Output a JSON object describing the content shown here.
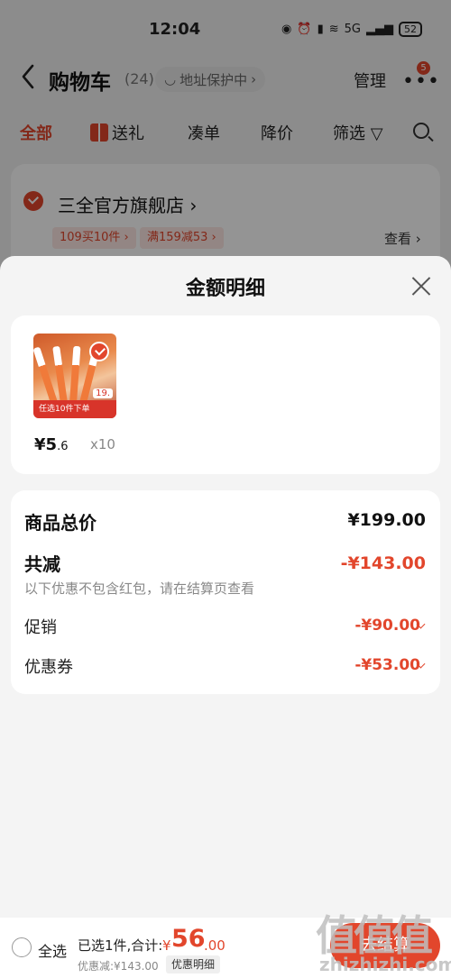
{
  "status_bar": {
    "time": "12:04",
    "network": "5G",
    "battery": "52"
  },
  "nav": {
    "title": "购物车",
    "count": "(24)",
    "address": "地址保护中",
    "manage": "管理",
    "badge": "5"
  },
  "tabs": [
    {
      "label": "全部"
    },
    {
      "label": "送礼"
    },
    {
      "label": "凑单"
    },
    {
      "label": "降价"
    },
    {
      "label": "筛选"
    }
  ],
  "store": {
    "name": "三全官方旗舰店 ›",
    "promo1": "109买10件 ›",
    "promo2": "满159减53 ›",
    "view": "查看 ›"
  },
  "sheet": {
    "title": "金额明细",
    "item": {
      "price_int": "¥5",
      "price_dec": ".6",
      "qty": "x10",
      "banner": "任选10件下单",
      "tag_price": "19."
    },
    "summary": {
      "total_label": "商品总价",
      "total_value": "¥199.00",
      "reduce_label": "共减",
      "reduce_value": "-¥143.00",
      "note": "以下优惠不包含红包，请在结算页查看",
      "promo_label": "促销",
      "promo_value": "-¥90.00",
      "coupon_label": "优惠券",
      "coupon_value": "-¥53.00"
    }
  },
  "bottom_bar": {
    "select_all": "全选",
    "selected": "已选1件,合计:",
    "currency": "¥",
    "amount_int": "56",
    "amount_dec": ".00",
    "discount": "优惠减:¥143.00",
    "detail_btn": "优惠明细",
    "checkout": "去结算"
  },
  "watermark": {
    "text": "值值值",
    "url": "zhizhizhi.com"
  },
  "colors": {
    "accent": "#e2462c",
    "overlay": "rgba(0,0,0,0.42)"
  }
}
